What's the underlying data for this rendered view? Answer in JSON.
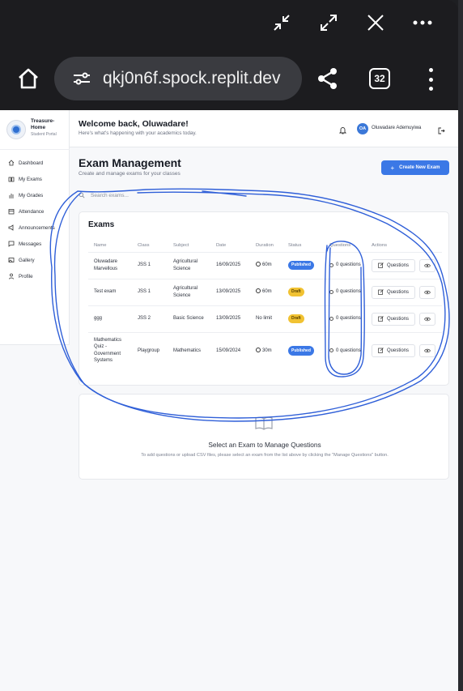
{
  "browser": {
    "url": "qkj0n6f.spock.replit.dev",
    "tab_count": "32",
    "window_controls": [
      "minimize-icon",
      "expand-icon",
      "close-icon",
      "more-icon"
    ]
  },
  "sidebar": {
    "brand_name": "Treasure-Home",
    "brand_sub": "Student Portal",
    "items": [
      {
        "label": "Dashboard",
        "icon": "home-icon"
      },
      {
        "label": "My Exams",
        "icon": "book-icon"
      },
      {
        "label": "My Grades",
        "icon": "chart-icon"
      },
      {
        "label": "Attendance",
        "icon": "calendar-icon"
      },
      {
        "label": "Announcements",
        "icon": "megaphone-icon"
      },
      {
        "label": "Messages",
        "icon": "message-icon"
      },
      {
        "label": "Gallery",
        "icon": "image-icon"
      },
      {
        "label": "Profile",
        "icon": "user-icon"
      }
    ]
  },
  "header": {
    "welcome": "Welcome back, Oluwadare!",
    "subtitle": "Here's what's happening with your academics today.",
    "avatar_initials": "OA",
    "user_name": "Oluwadare Ademuyiwa"
  },
  "main": {
    "title": "Exam Management",
    "subtitle": "Create and manage exams for your classes",
    "create_button": "Create New Exam",
    "search_placeholder": "Search exams...",
    "exams_title": "Exams",
    "columns": [
      "Name",
      "Class",
      "Subject",
      "Date",
      "Duration",
      "Status",
      "Questions",
      "Actions"
    ],
    "rows": [
      {
        "name": "Oluwadare Marvellous",
        "class": "JSS 1",
        "subject": "Agricultural Science",
        "date": "16/09/2025",
        "duration": "60m",
        "status": "Published",
        "questions": "0 questions",
        "action": "Questions"
      },
      {
        "name": "Test exam",
        "class": "JSS 1",
        "subject": "Agricultural Science",
        "date": "13/09/2025",
        "duration": "60m",
        "status": "Draft",
        "questions": "0 questions",
        "action": "Questions"
      },
      {
        "name": "ggg",
        "class": "JSS 2",
        "subject": "Basic Science",
        "date": "13/09/2025",
        "duration": "No limit",
        "status": "Draft",
        "questions": "0 questions",
        "action": "Questions"
      },
      {
        "name": "Mathematics Quiz - Government Systems",
        "class": "Playgroup",
        "subject": "Mathematics",
        "date": "15/09/2024",
        "duration": "30m",
        "status": "Published",
        "questions": "0 questions",
        "action": "Questions"
      }
    ],
    "empty_title": "Select an Exam to Manage Questions",
    "empty_sub": "To add questions or upload CSV files, please select an exam from the list above by clicking the \"Manage Questions\" button."
  },
  "colors": {
    "accent": "#3b78e6",
    "draft": "#f1c232",
    "annotation": "#2f5fd8"
  }
}
